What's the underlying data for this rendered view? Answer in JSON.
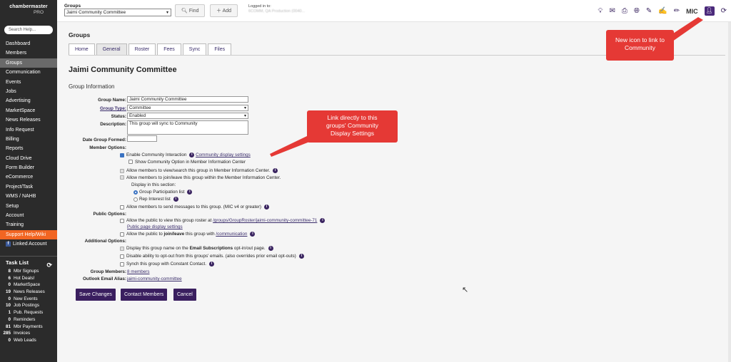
{
  "sidebar": {
    "logo_line1": "chambermaster",
    "logo_line2": "PRO",
    "search_placeholder": "Search Help...",
    "items": [
      "Dashboard",
      "Members",
      "Groups",
      "Communication",
      "Events",
      "Jobs",
      "Advertising",
      "MarketSpace",
      "News Releases",
      "Info Request",
      "Billing",
      "Reports",
      "Cloud Drive",
      "Form Builder",
      "eCommerce",
      "Project/Task",
      "WMS / NAHB",
      "Setup",
      "Account",
      "Training",
      "Support Help/Wiki"
    ],
    "linked_account": "Linked Account",
    "task_list_title": "Task List",
    "tasks": [
      {
        "n": "8",
        "label": "Mbr Signups"
      },
      {
        "n": "6",
        "label": "Hot Deals!"
      },
      {
        "n": "0",
        "label": "MarketSpace"
      },
      {
        "n": "19",
        "label": "News Releases"
      },
      {
        "n": "0",
        "label": "New Events"
      },
      {
        "n": "10",
        "label": "Job Postings"
      },
      {
        "n": "1",
        "label": "Pub. Requests"
      },
      {
        "n": "0",
        "label": "Reminders"
      },
      {
        "n": "81",
        "label": "Mbr Payments"
      },
      {
        "n": "285",
        "label": "Invoices"
      },
      {
        "n": "0",
        "label": "Web Leads"
      }
    ]
  },
  "topbar": {
    "groups_label": "Groups",
    "groups_selected": "Jaimi Community Committee",
    "find": "Find",
    "add": "Add",
    "logged_label": "Logged in to:",
    "logged_value": "6COMM, QA Production (0040...",
    "mic": "MIC"
  },
  "main": {
    "page_title": "Groups",
    "tabs": [
      "Home",
      "General",
      "Roster",
      "Fees",
      "Sync",
      "Files"
    ],
    "group_heading": "Jaimi Community Committee",
    "section": "Group Information"
  },
  "form": {
    "group_name_label": "Group Name:",
    "group_name": "Jaimi Community Committee",
    "group_type_label": "Group Type:",
    "group_type": "Committee",
    "status_label": "Status:",
    "status": "Enabled",
    "description_label": "Description:",
    "description": "This group will sync to Community",
    "date_formed_label": "Date Group Formed:",
    "member_options_label": "Member Options:",
    "enable_community": "Enable Community Interaction",
    "community_link": "Community display settings",
    "show_option": "Show Community Option in Member Information Center",
    "allow_view": "Allow members to view/search this group in Member Information Center.",
    "allow_join": "Allow members to join/leave this group within the Member Information Center.",
    "display_in": "Display in this section:",
    "radio1": "Group Participation list",
    "radio2": "Rep Interest list",
    "allow_messages": "Allow members to send messages to this group. (MIC v4 or greater)",
    "public_options_label": "Public Options:",
    "public_view": "Allow the public to view this group roster at ",
    "public_url": "/groups/GroupRoster/jaimi-community-committee-71",
    "public_display": "Public page display settings",
    "public_join_pre": "Allow the public to ",
    "public_join_bold": "join/leave",
    "public_join_mid": " this group with ",
    "public_join_link": "/communication",
    "additional_label": "Additional Options:",
    "add1_pre": "Display this group name on the ",
    "add1_bold": "Email Subscriptions",
    "add1_post": " opt-in/out page.",
    "add2": "Disable ability to opt-out from this groups' emails. (also overrides prior email opt-outs)",
    "add3": "Synch this group with Constant Contact.",
    "group_members_label": "Group Members:",
    "group_members": "8 members",
    "outlook_label": "Outlook Email Alias:",
    "outlook": "jaimi-community-committee"
  },
  "buttons": {
    "save": "Save Changes",
    "contact": "Contact Members",
    "cancel": "Cancel"
  },
  "callouts": {
    "mic": "New icon to link to Community",
    "settings": "Link directly to this groups' Community Display Settings"
  },
  "colors": {
    "sidebar": "#2b2b2b",
    "accent": "#3a1f5f",
    "callout": "#e53935",
    "support": "#f26522"
  }
}
